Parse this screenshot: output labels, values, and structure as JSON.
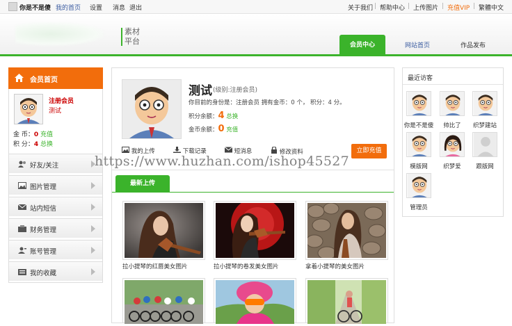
{
  "topbar": {
    "nickname": "你是不是傻",
    "links": [
      "我的首页",
      "设置",
      "消息",
      "退出"
    ],
    "right_links": [
      "关于我们",
      "帮助中心",
      "上传图片",
      "充值VIP",
      "繁體中文"
    ],
    "vip_color": "#f26d0c"
  },
  "header": {
    "logo_text_line1": "素材",
    "logo_text_line2": "平台",
    "nav": [
      "会员中心",
      "网站首页",
      "作品发布"
    ],
    "accent": "#3bb32b"
  },
  "sidebar": {
    "title": "会员首页",
    "user_role": "注册会员",
    "user_name": "测试",
    "coin_label": "金 币：",
    "coin_value": "0",
    "coin_action": "充值",
    "points_label": "积 分：",
    "points_value": "4",
    "points_action": "总换",
    "menu": [
      {
        "label": "好友/关注",
        "icon": "friends-icon"
      },
      {
        "label": "图片管理",
        "icon": "image-icon"
      },
      {
        "label": "站内短信",
        "icon": "mail-icon"
      },
      {
        "label": "财务管理",
        "icon": "finance-icon"
      },
      {
        "label": "账号管理",
        "icon": "account-icon"
      },
      {
        "label": "我的收藏",
        "icon": "favorite-icon"
      }
    ]
  },
  "profile": {
    "name": "测试",
    "level": "(级别:注册会员)",
    "desc": "你目前的身份是：注册会员 拥有金币：0 个， 积分：4 分。",
    "points_label": "积分余额：",
    "points_value": "4",
    "points_action": "总换",
    "coin_label": "金币余额：",
    "coin_value": "0",
    "coin_action": "充值",
    "actions": [
      {
        "label": "我的上传",
        "icon": "upload-image-icon"
      },
      {
        "label": "下载记录",
        "icon": "download-icon"
      },
      {
        "label": "短消息",
        "icon": "message-icon"
      },
      {
        "label": "修改资料",
        "icon": "lock-icon"
      }
    ],
    "recharge_button": "立即充值"
  },
  "gallery": {
    "tab": "最新上传",
    "items": [
      {
        "caption": "拉小提琴的红唇美女图片"
      },
      {
        "caption": "拉小提琴的卷发美女图片"
      },
      {
        "caption": "拿着小提琴的美女图片"
      },
      {
        "caption": ""
      },
      {
        "caption": ""
      },
      {
        "caption": ""
      }
    ]
  },
  "visitors": {
    "title": "最近访客",
    "list": [
      "你是不是傻",
      "帅比了",
      "织梦建站",
      "模版网",
      "织梦爱",
      "跟版网",
      "管理员"
    ]
  },
  "watermark": "https://www.huzhan.com/ishop45527"
}
